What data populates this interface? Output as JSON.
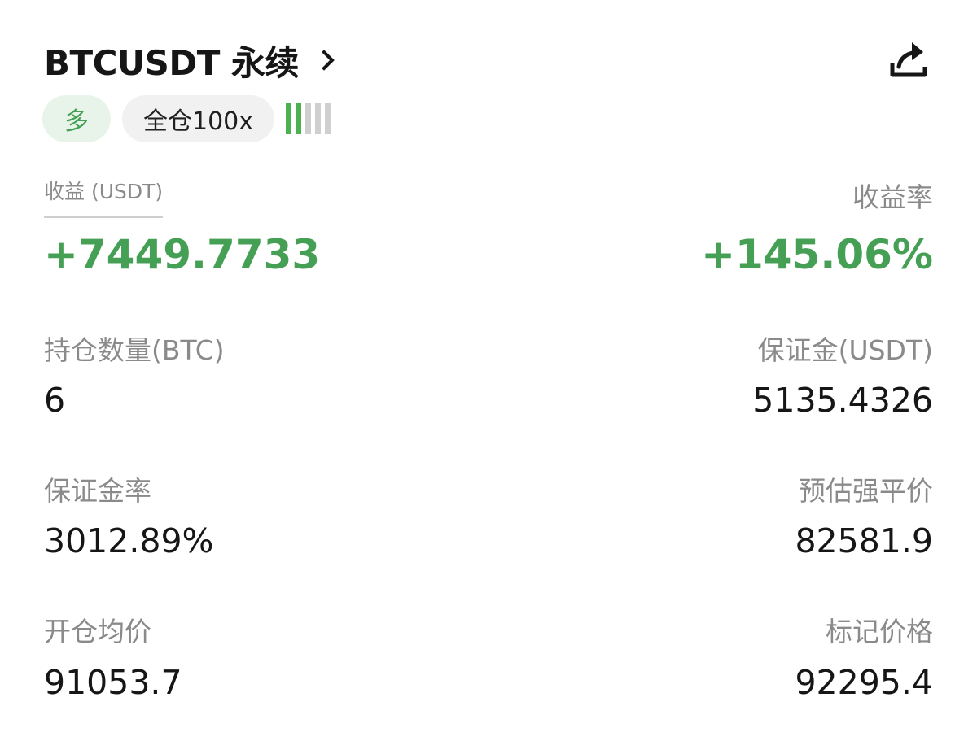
{
  "header": {
    "symbol": "BTCUSDT 永续",
    "side": "多",
    "margin_mode": "全仓100x",
    "risk_level": 2,
    "risk_level_max": 5
  },
  "pnl": {
    "label": "收益 (USDT)",
    "value": "+7449.7733",
    "rate_label": "收益率",
    "rate_value": "+145.06%"
  },
  "stats": {
    "position_size_label": "持仓数量(BTC)",
    "position_size_value": "6",
    "margin_label": "保证金(USDT)",
    "margin_value": "5135.4326",
    "margin_ratio_label": "保证金率",
    "margin_ratio_value": "3012.89%",
    "liq_price_label": "预估强平价",
    "liq_price_value": "82581.9",
    "entry_price_label": "开仓均价",
    "entry_price_value": "91053.7",
    "mark_price_label": "标记价格",
    "mark_price_value": "92295.4"
  },
  "colors": {
    "profit_green": "#45a055",
    "long_tag_bg": "#e8f4e9",
    "risk_bar_on": "#4caf50",
    "risk_bar_off": "#cfcfcf"
  },
  "icons": {
    "title_chevron": "chevron-right-icon",
    "share": "share-icon"
  }
}
